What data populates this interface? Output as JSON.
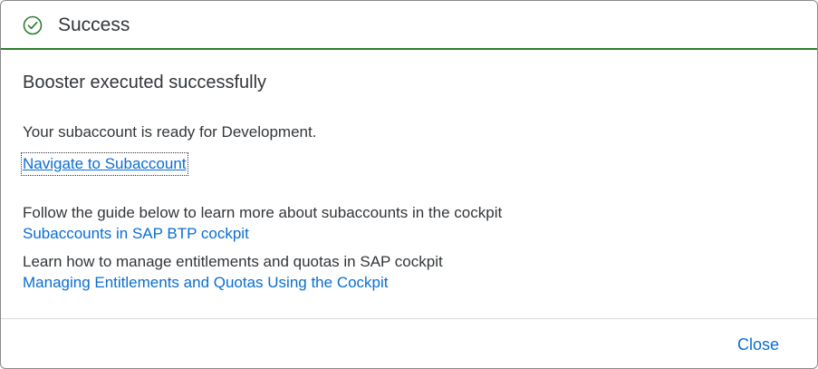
{
  "header": {
    "title": "Success",
    "icon": "check-circle-icon",
    "accent_color": "#2b7d2b"
  },
  "content": {
    "headline": "Booster executed successfully",
    "ready_text": "Your subaccount is ready for Development.",
    "navigate_link": "Navigate to Subaccount",
    "guide_text": "Follow the guide below to learn more about subaccounts in the cockpit",
    "guide_link": "Subaccounts in SAP BTP cockpit",
    "entitlements_text": "Learn how to manage entitlements and quotas in SAP cockpit",
    "entitlements_link": "Managing Entitlements and Quotas Using the Cockpit",
    "link_color": "#0a6ed1"
  },
  "footer": {
    "close_label": "Close"
  }
}
